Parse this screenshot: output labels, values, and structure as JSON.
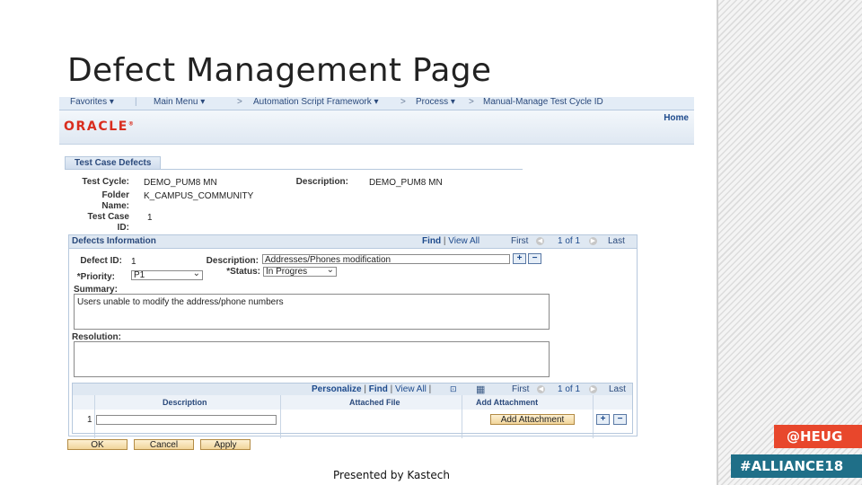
{
  "slide": {
    "title": "Defect Management Page",
    "footer": "Presented by Kastech",
    "badges": {
      "heug": "@HEUG",
      "alliance": "#ALLIANCE18"
    }
  },
  "nav": {
    "favorites": "Favorites ▾",
    "main_menu": "Main Menu ▾",
    "sep": ">",
    "automation": "Automation Script Framework ▾",
    "process": "Process ▾",
    "manual": "Manual-Manage Test Cycle ID",
    "home": "Home"
  },
  "brand": {
    "logo": "ORACLE",
    "reg": "®"
  },
  "tab": {
    "label": "Test Case Defects"
  },
  "header_fields": {
    "test_cycle_label": "Test Cycle:",
    "test_cycle_value": "DEMO_PUM8 MN",
    "description_label": "Description:",
    "description_value": "DEMO_PUM8 MN",
    "folder_label_1": "Folder",
    "folder_label_2": "Name:",
    "folder_value": "K_CAMPUS_COMMUNITY",
    "test_case_label_1": "Test Case",
    "test_case_label_2": "ID:",
    "test_case_value": "1"
  },
  "defects": {
    "section_title": "Defects Information",
    "find": "Find",
    "sep": "|",
    "view_all": "View All",
    "first": "First",
    "page": "1 of 1",
    "last": "Last",
    "defect_id_label": "Defect ID:",
    "defect_id_value": "1",
    "description_label": "Description:",
    "description_value": "Addresses/Phones modification",
    "priority_label": "*Priority:",
    "priority_value": "P1",
    "status_label": "*Status:",
    "status_value": "In Progres",
    "summary_label": "Summary:",
    "summary_value": "Users unable to modify the address/phone numbers",
    "resolution_label": "Resolution:",
    "plus": "+",
    "minus": "−"
  },
  "attachments": {
    "personalize": "Personalize",
    "find": "Find",
    "view_all": "View All",
    "first": "First",
    "page": "1 of 1",
    "last": "Last",
    "col_description": "Description",
    "col_attached_file": "Attached File",
    "col_add_attachment": "Add Attachment",
    "row_num": "1",
    "add_attachment_button": "Add Attachment",
    "plus": "+",
    "minus": "−"
  },
  "buttons": {
    "ok": "OK",
    "cancel": "Cancel",
    "apply": "Apply"
  }
}
